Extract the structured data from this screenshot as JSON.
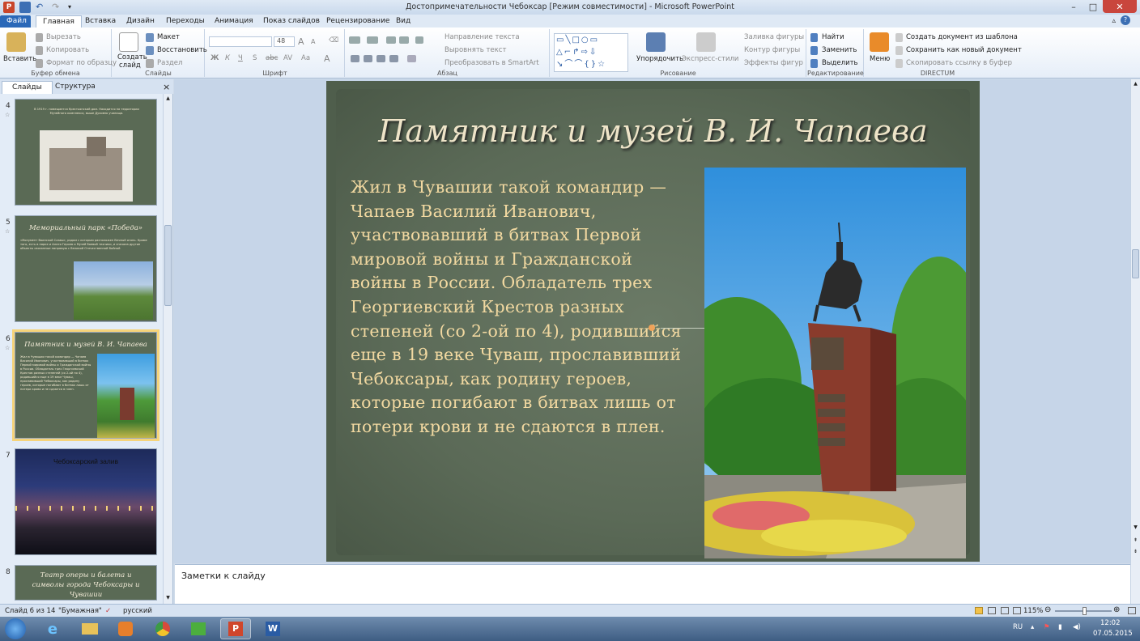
{
  "window": {
    "title": "Достопримечательности Чебоксар [Режим совместимости] - Microsoft PowerPoint"
  },
  "tabs": [
    {
      "label": "Файл"
    },
    {
      "label": "Главная"
    },
    {
      "label": "Вставка"
    },
    {
      "label": "Дизайн"
    },
    {
      "label": "Переходы"
    },
    {
      "label": "Анимация"
    },
    {
      "label": "Показ слайдов"
    },
    {
      "label": "Рецензирование"
    },
    {
      "label": "Вид"
    }
  ],
  "ribbon": {
    "clipboard": {
      "paste": "Вставить",
      "cut": "Вырезать",
      "copy": "Копировать",
      "format_painter": "Формат по образцу",
      "label": "Буфер обмена"
    },
    "slides": {
      "new_slide": "Создать",
      "new_slide2": "слайд",
      "layout": "Макет",
      "reset": "Восстановить",
      "section": "Раздел",
      "label": "Слайды"
    },
    "font": {
      "size": "48",
      "label": "Шрифт",
      "bold": "Ж",
      "italic": "К",
      "underline": "Ч",
      "shadow": "S",
      "strike": "abc",
      "spacing": "AV",
      "case": "Aa",
      "color": "A",
      "grow": "A",
      "shrink": "A"
    },
    "paragraph": {
      "text_direction": "Направление текста",
      "align_text": "Выровнять текст",
      "smartart": "Преобразовать в SmartArt",
      "label": "Абзац"
    },
    "drawing": {
      "arrange": "Упорядочить",
      "quick_styles": "Экспресс-стили",
      "shape_fill": "Заливка фигуры",
      "shape_outline": "Контур фигуры",
      "shape_effects": "Эффекты фигур",
      "label": "Рисование"
    },
    "editing": {
      "find": "Найти",
      "replace": "Заменить",
      "select": "Выделить",
      "label": "Редактирование"
    },
    "directum": {
      "menu": "Меню",
      "create_from_template": "Создать документ из шаблона",
      "save_as_new": "Сохранить как новый документ",
      "copy_link": "Скопировать ссылку в буфер",
      "label": "DIRECTUM"
    }
  },
  "leftpane": {
    "tabs": [
      "Слайды",
      "Структура"
    ],
    "close": "×",
    "slides": [
      {
        "num": "4",
        "text": "В 1919 г. помещается Крестьянский дом. Находится на территории Музейного комплекса, выше Духовно училища."
      },
      {
        "num": "5",
        "title": "Мемориальный парк «Победа»",
        "text": "«Монумент Воинской Славы», рядом с которым расположен Вечный огонь. Кроме того, есть в парке и Аллея Героев и Музей боевой техники, и сначала другие объекты связанные напрямую с Великой Отечественной Войной"
      },
      {
        "num": "6",
        "title": "Памятник и музей В. И. Чапаева",
        "text": "Жил в Чувашии такой командир — Чапаев Василий Иванович, участвовавший в битвах Первой мировой войны и Гражданской войны в России. Обладатель трех Георгиевский Крестов разных степеней (со 2-ой по 4), родившийся еще в 19 веке Чуваш, прославивший Чебоксары, как родину героев, которые погибают в битвах лишь от потери крови и не сдаются в плен."
      },
      {
        "num": "7",
        "title": "Чебоксарский залив"
      },
      {
        "num": "8",
        "title": "Театр оперы и балета и символы города Чебоксары и Чувашии"
      }
    ]
  },
  "slide": {
    "title": "Памятник и музей В. И. Чапаева",
    "body": "Жил в Чувашии такой командир — Чапаев Василий Иванович, участвовавший в битвах Первой мировой войны и Гражданской войны в России. Обладатель трех Георгиевский Крестов разных степеней (со 2-ой по 4), родившийся еще в 19 веке Чуваш, прославивший Чебоксары, как родину героев, которые погибают в битвах лишь от потери крови и не сдаются в плен."
  },
  "notes": {
    "placeholder": "Заметки к слайду"
  },
  "status": {
    "slide_of": "Слайд 6 из 14",
    "theme": "\"Бумажная\"",
    "language": "русский",
    "zoom": "115%"
  },
  "taskbar": {
    "lang": "RU",
    "time": "12:02",
    "date": "07.05.2015"
  }
}
